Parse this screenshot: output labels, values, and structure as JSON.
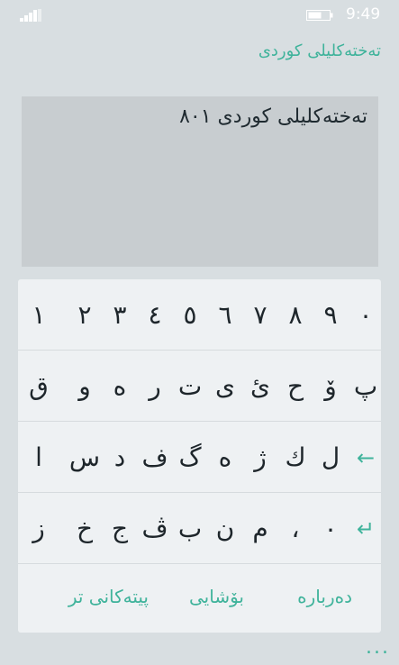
{
  "status": {
    "time": "9:49"
  },
  "app": {
    "title": "تەختەکلیلی کوردی"
  },
  "editor": {
    "text": "تەختەکلیلی کوردی ٨٠١"
  },
  "keyboard": {
    "rows": [
      [
        "٠",
        "٩",
        "٨",
        "٧",
        "٦",
        "٥",
        "٤",
        "٣",
        "٢",
        "١"
      ],
      [
        "پ",
        "ۆ",
        "ح",
        "ئ",
        "ی",
        "ت",
        "ر",
        "ە",
        "و",
        "ق"
      ],
      [
        "←",
        "ل",
        "ك",
        "ژ",
        "ە",
        "گ",
        "ف",
        "د",
        "س",
        "ا"
      ],
      [
        "↵",
        "٠",
        "،",
        "م",
        "ن",
        "ب",
        "ڤ",
        "ج",
        "خ",
        "ز"
      ]
    ]
  },
  "menu": {
    "about": "دەربارە",
    "clear": "بۆشایی",
    "other_letters": "پیتەکانی تر"
  },
  "more": "...",
  "colors": {
    "accent": "#3fb39b",
    "background": "#d8dee1",
    "panel": "#eef1f3",
    "textarea": "#c8cdd0"
  },
  "icons": [
    "signal-icon",
    "battery-icon",
    "backspace-arrow-icon",
    "enter-icon",
    "more-dots-icon"
  ]
}
